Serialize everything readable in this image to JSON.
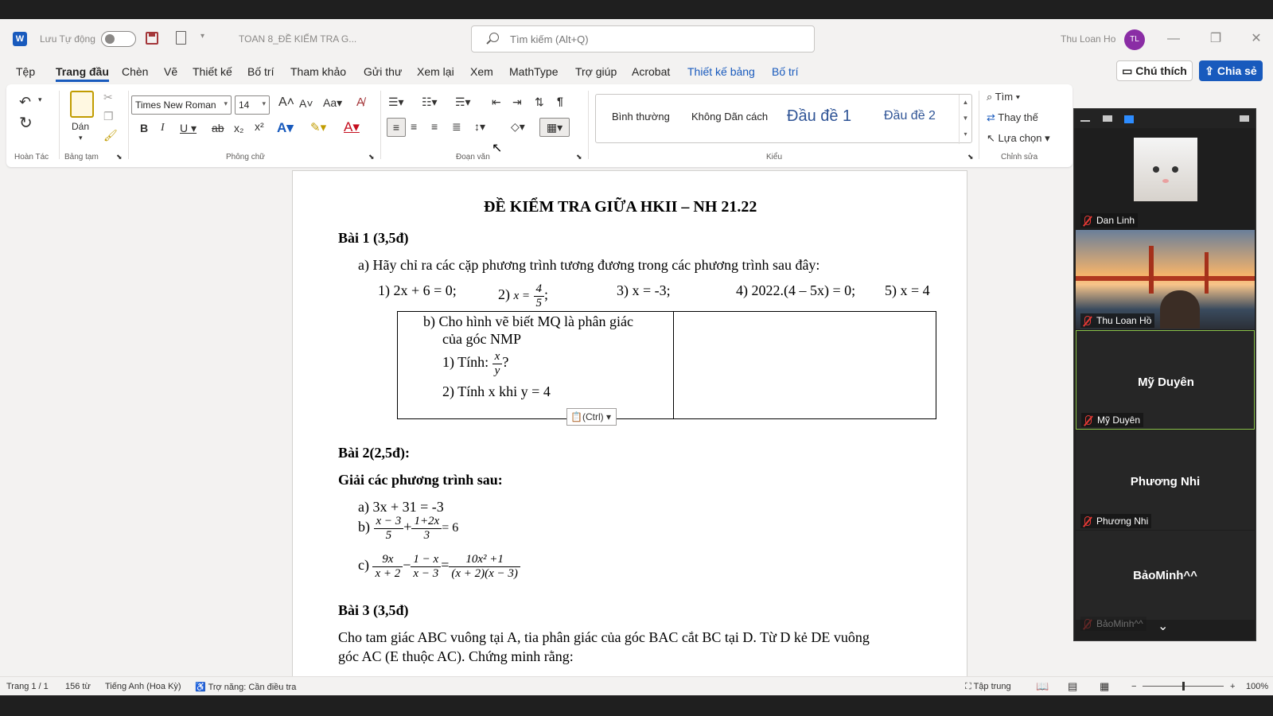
{
  "app": {
    "autosave_label": "Lưu Tự động",
    "doc_title": "TOAN 8_ĐỀ KIỂM TRA G...",
    "search_placeholder": "Tìm kiếm (Alt+Q)",
    "user_name": "Thu Loan Ho",
    "user_initials": "TL"
  },
  "menu": {
    "tabs": [
      "Tệp",
      "Trang đầu",
      "Chèn",
      "Vẽ",
      "Thiết kế",
      "Bố trí",
      "Tham khảo",
      "Gửi thư",
      "Xem lại",
      "Xem",
      "MathType",
      "Trợ giúp",
      "Acrobat",
      "Thiết kế bảng",
      "Bố trí"
    ],
    "active": "Trang đầu",
    "comment_button": "Chú thích",
    "share_button": "Chia sẻ"
  },
  "ribbon": {
    "groups": [
      "Hoàn Tác",
      "Bảng tạm",
      "Phông chữ",
      "Đoạn văn",
      "Kiểu",
      "Chỉnh sửa"
    ],
    "paste_label": "Dán",
    "font_name": "Times New Roman",
    "font_size": "14",
    "styles": [
      "Bình thường",
      "Không Dãn cách",
      "Đầu đề 1",
      "Đầu đề 2"
    ],
    "find_label": "Tìm",
    "replace_label": "Thay thế",
    "select_label": "Lựa chọn"
  },
  "document": {
    "title": "ĐỀ KIỂM TRA GIỮA HKII – NH 21.22",
    "bai1_heading": "Bài 1 (3,5đ)",
    "bai1_a": "a)  Hãy chỉ ra các cặp phương trình tương đương trong các phương trình sau đây:",
    "eq1": "1)  2x + 6 = 0;",
    "eq2_prefix": "2)",
    "eq2_var": "x =",
    "eq2_num": "4",
    "eq2_den": "5",
    "eq2_suffix": ";",
    "eq3": "3) x = -3;",
    "eq4": "4) 2022.(4 – 5x) = 0;",
    "eq5": "5) x = 4",
    "bai1_b_line1": "b)  Cho hình vẽ biết MQ là phân giác",
    "bai1_b_line2": "của góc NMP",
    "bai1_b_q1_prefix": "1)  Tính:",
    "bai1_b_q1_num": "x",
    "bai1_b_q1_den": "y",
    "bai1_b_q1_suffix": "?",
    "bai1_b_q2": "2)  Tính x khi y = 4",
    "ctrl_tag": "(Ctrl)",
    "bai2_heading": "Bài 2(2,5đ):",
    "bai2_sub": "Giải các phương trình sau:",
    "bai2_a": "a)  3x + 31 = -3",
    "bai2_b_prefix": "b)",
    "bai2_b_f1_num": "x − 3",
    "bai2_b_f1_den": "5",
    "bai2_b_plus": "+",
    "bai2_b_f2_num": "1+2x",
    "bai2_b_f2_den": "3",
    "bai2_b_rhs": "= 6",
    "bai2_c_prefix": "c)",
    "bai2_c_f1_num": "9x",
    "bai2_c_f1_den": "x + 2",
    "bai2_c_minus": "−",
    "bai2_c_f2_num": "1 − x",
    "bai2_c_f2_den": "x − 3",
    "bai2_c_eq": "=",
    "bai2_c_f3_num": "10x² +1",
    "bai2_c_f3_den": "(x + 2)(x − 3)",
    "bai3_heading": "Bài 3 (3,5đ)",
    "bai3_line1": "Cho tam giác ABC vuông tại A, tia phân giác của góc BAC cắt BC tại D. Từ D kẻ DE vuông",
    "bai3_line2": "góc AC (E thuộc AC). Chứng minh rằng:"
  },
  "status": {
    "page": "Trang 1 / 1",
    "words": "156 từ",
    "language": "Tiếng Anh (Hoa Kỳ)",
    "accessibility": "Trợ năng: Cần điều tra",
    "focus": "Tập trung",
    "zoom": "100%"
  },
  "meeting": {
    "participants": [
      {
        "name": "Dan Linh",
        "has_video": true
      },
      {
        "name": "Thu Loan Hồ",
        "has_video": true
      },
      {
        "name": "Mỹ Duyên",
        "has_video": false,
        "active": true
      },
      {
        "name": "Phương Nhi",
        "has_video": false
      },
      {
        "name": "BảoMinh^^",
        "has_video": false
      }
    ],
    "tile_names": [
      "Mỹ Duyên",
      "Phương Nhi",
      "BảoMinh^^"
    ],
    "labels": [
      "Dan Linh",
      "Thu Loan Hồ",
      "Mỹ Duyên",
      "Phương Nhi",
      "BảoMinh^^"
    ]
  }
}
